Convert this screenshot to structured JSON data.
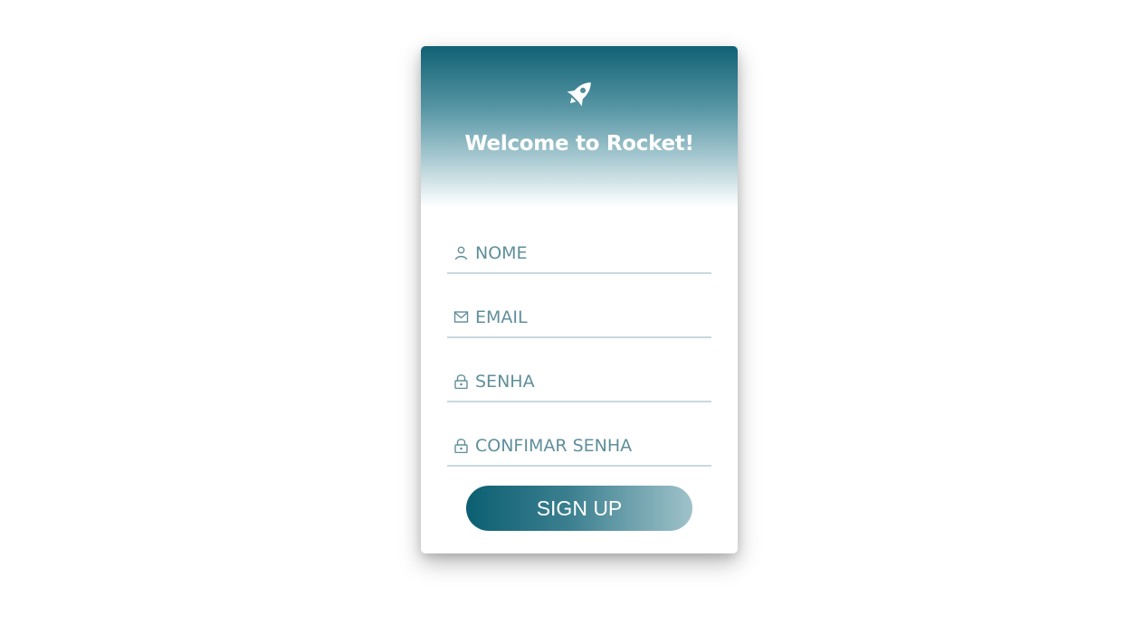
{
  "card": {
    "title": "Welcome to Rocket!",
    "logo_icon": "rocket-icon"
  },
  "form": {
    "fields": [
      {
        "name": "nome",
        "placeholder": "NOME",
        "value": "",
        "icon": "user-icon"
      },
      {
        "name": "email",
        "placeholder": "EMAIL",
        "value": "",
        "icon": "mail-icon"
      },
      {
        "name": "senha",
        "placeholder": "SENHA",
        "value": "",
        "icon": "lock-icon"
      },
      {
        "name": "confirmar_senha",
        "placeholder": "CONFIMAR SENHA",
        "value": "",
        "icon": "lock-icon"
      }
    ],
    "submit_label": "SIGN UP"
  },
  "colors": {
    "accent": "#0f6174",
    "field_text": "#5f8f9b",
    "field_line": "#c8d9de"
  }
}
